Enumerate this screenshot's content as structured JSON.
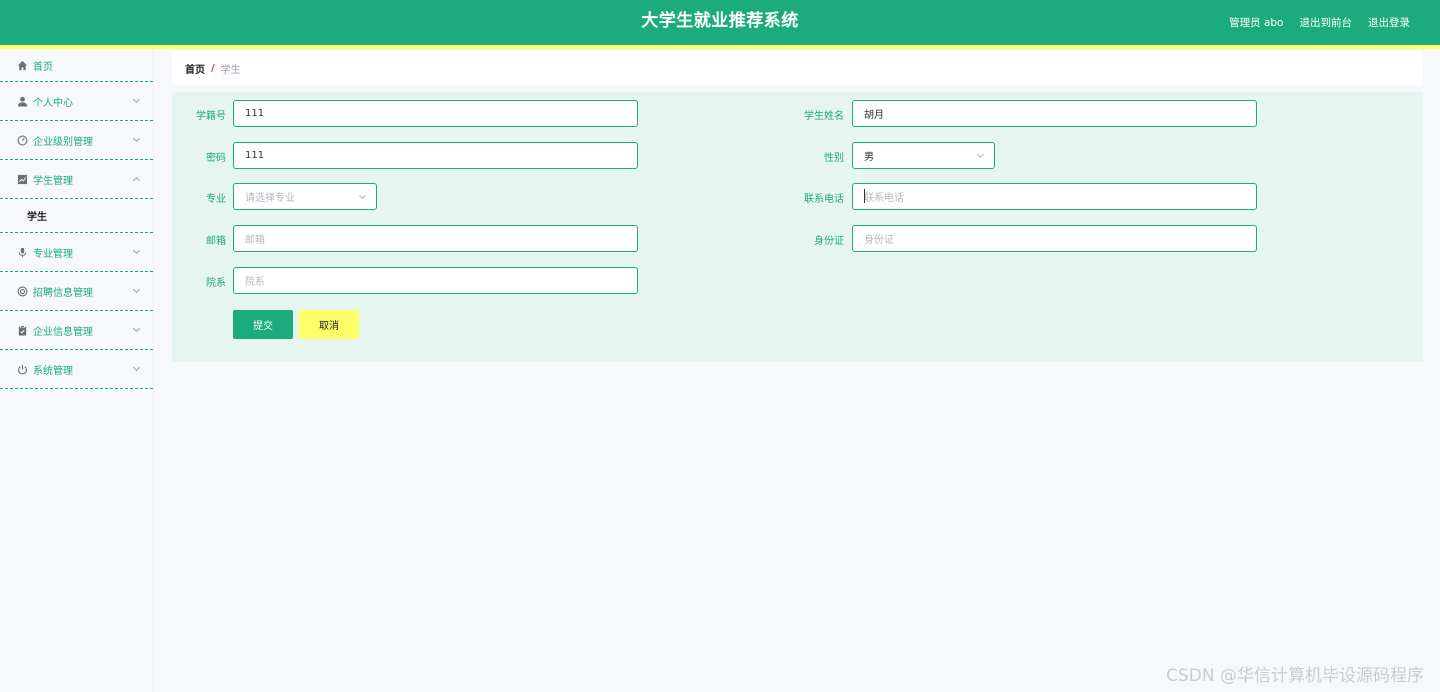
{
  "header": {
    "title": "大学生就业推荐系统",
    "user": "管理员 abo",
    "front_link": "退出到前台",
    "logout_link": "退出登录",
    "colors": {
      "primary": "#1bab7c",
      "accent_yellow": "#fcff66"
    }
  },
  "sidebar": {
    "items": [
      {
        "label": "首页",
        "icon": "home-icon"
      },
      {
        "label": "个人中心",
        "icon": "user-icon"
      },
      {
        "label": "企业级别管理",
        "icon": "gauge-icon"
      },
      {
        "label": "学生管理",
        "icon": "chart-icon",
        "expanded": true,
        "children": [
          "学生"
        ]
      },
      {
        "label": "专业管理",
        "icon": "microphone-icon"
      },
      {
        "label": "招聘信息管理",
        "icon": "support-icon"
      },
      {
        "label": "企业信息管理",
        "icon": "clipboard-icon"
      },
      {
        "label": "系统管理",
        "icon": "power-icon"
      }
    ]
  },
  "breadcrumb": {
    "home": "首页",
    "separator": "/",
    "current": "学生"
  },
  "form": {
    "student_no": {
      "label": "学籍号",
      "value": "111"
    },
    "student_name": {
      "label": "学生姓名",
      "value": "胡月"
    },
    "password": {
      "label": "密码",
      "value": "111"
    },
    "gender": {
      "label": "性别",
      "value": "男"
    },
    "major": {
      "label": "专业",
      "placeholder": "请选择专业"
    },
    "phone": {
      "label": "联系电话",
      "placeholder": "联系电话"
    },
    "email": {
      "label": "邮箱",
      "placeholder": "邮箱"
    },
    "id_card": {
      "label": "身份证",
      "placeholder": "身份证"
    },
    "department": {
      "label": "院系",
      "placeholder": "院系"
    },
    "submit_label": "提交",
    "cancel_label": "取消"
  },
  "watermark": "CSDN @华信计算机毕设源码程序"
}
